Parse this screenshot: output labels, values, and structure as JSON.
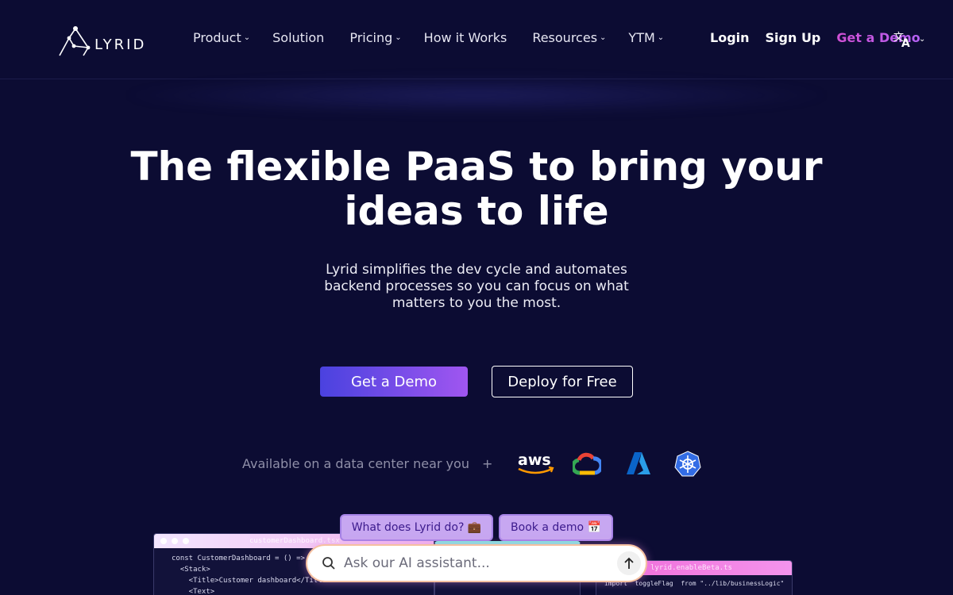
{
  "brand": {
    "name": "LYRID"
  },
  "nav": {
    "links": [
      {
        "label": "Product",
        "dropdown": true
      },
      {
        "label": "Solution",
        "dropdown": false
      },
      {
        "label": "Pricing",
        "dropdown": true
      },
      {
        "label": "How it Works",
        "dropdown": false
      },
      {
        "label": "Resources",
        "dropdown": true
      },
      {
        "label": "YTM",
        "dropdown": true
      }
    ],
    "login": "Login",
    "signup": "Sign Up",
    "demo": "Get a Demo",
    "language_icon": "translate-icon"
  },
  "hero": {
    "title_line1": "The flexible PaaS to bring your",
    "title_line2": "ideas to life",
    "subtitle": "Lyrid simplifies the dev cycle and automates backend processes so you can focus on what matters to you the most.",
    "primary_cta": "Get a Demo",
    "secondary_cta": "Deploy for Free"
  },
  "availability": {
    "text": "Available on a data center near you",
    "plus": "+",
    "provider_logos": [
      "aws-logo",
      "google-cloud-logo",
      "azure-logo",
      "kubernetes-logo"
    ],
    "aws_text": "aws"
  },
  "previews": {
    "left_title": "customerDashboard.tsx",
    "left_code": [
      "const CustomerDashboard = () => (",
      "  <Stack>",
      "    <Title>Customer dashboard</Title>",
      "    <Text>"
    ],
    "right_title": "lyrid.enableBeta.ts",
    "right_code": [
      "import  toggleFlag  from \"../lib/businessLogic\""
    ]
  },
  "assistant": {
    "suggestions": [
      "What does Lyrid do? 💼",
      "Book a demo 📅"
    ],
    "placeholder": "Ask our AI assistant..."
  },
  "colors": {
    "background": "#0c0c33",
    "accent_gradient_start": "#4a42df",
    "accent_gradient_end": "#a056f0",
    "demo_link": "#d04fd3"
  }
}
